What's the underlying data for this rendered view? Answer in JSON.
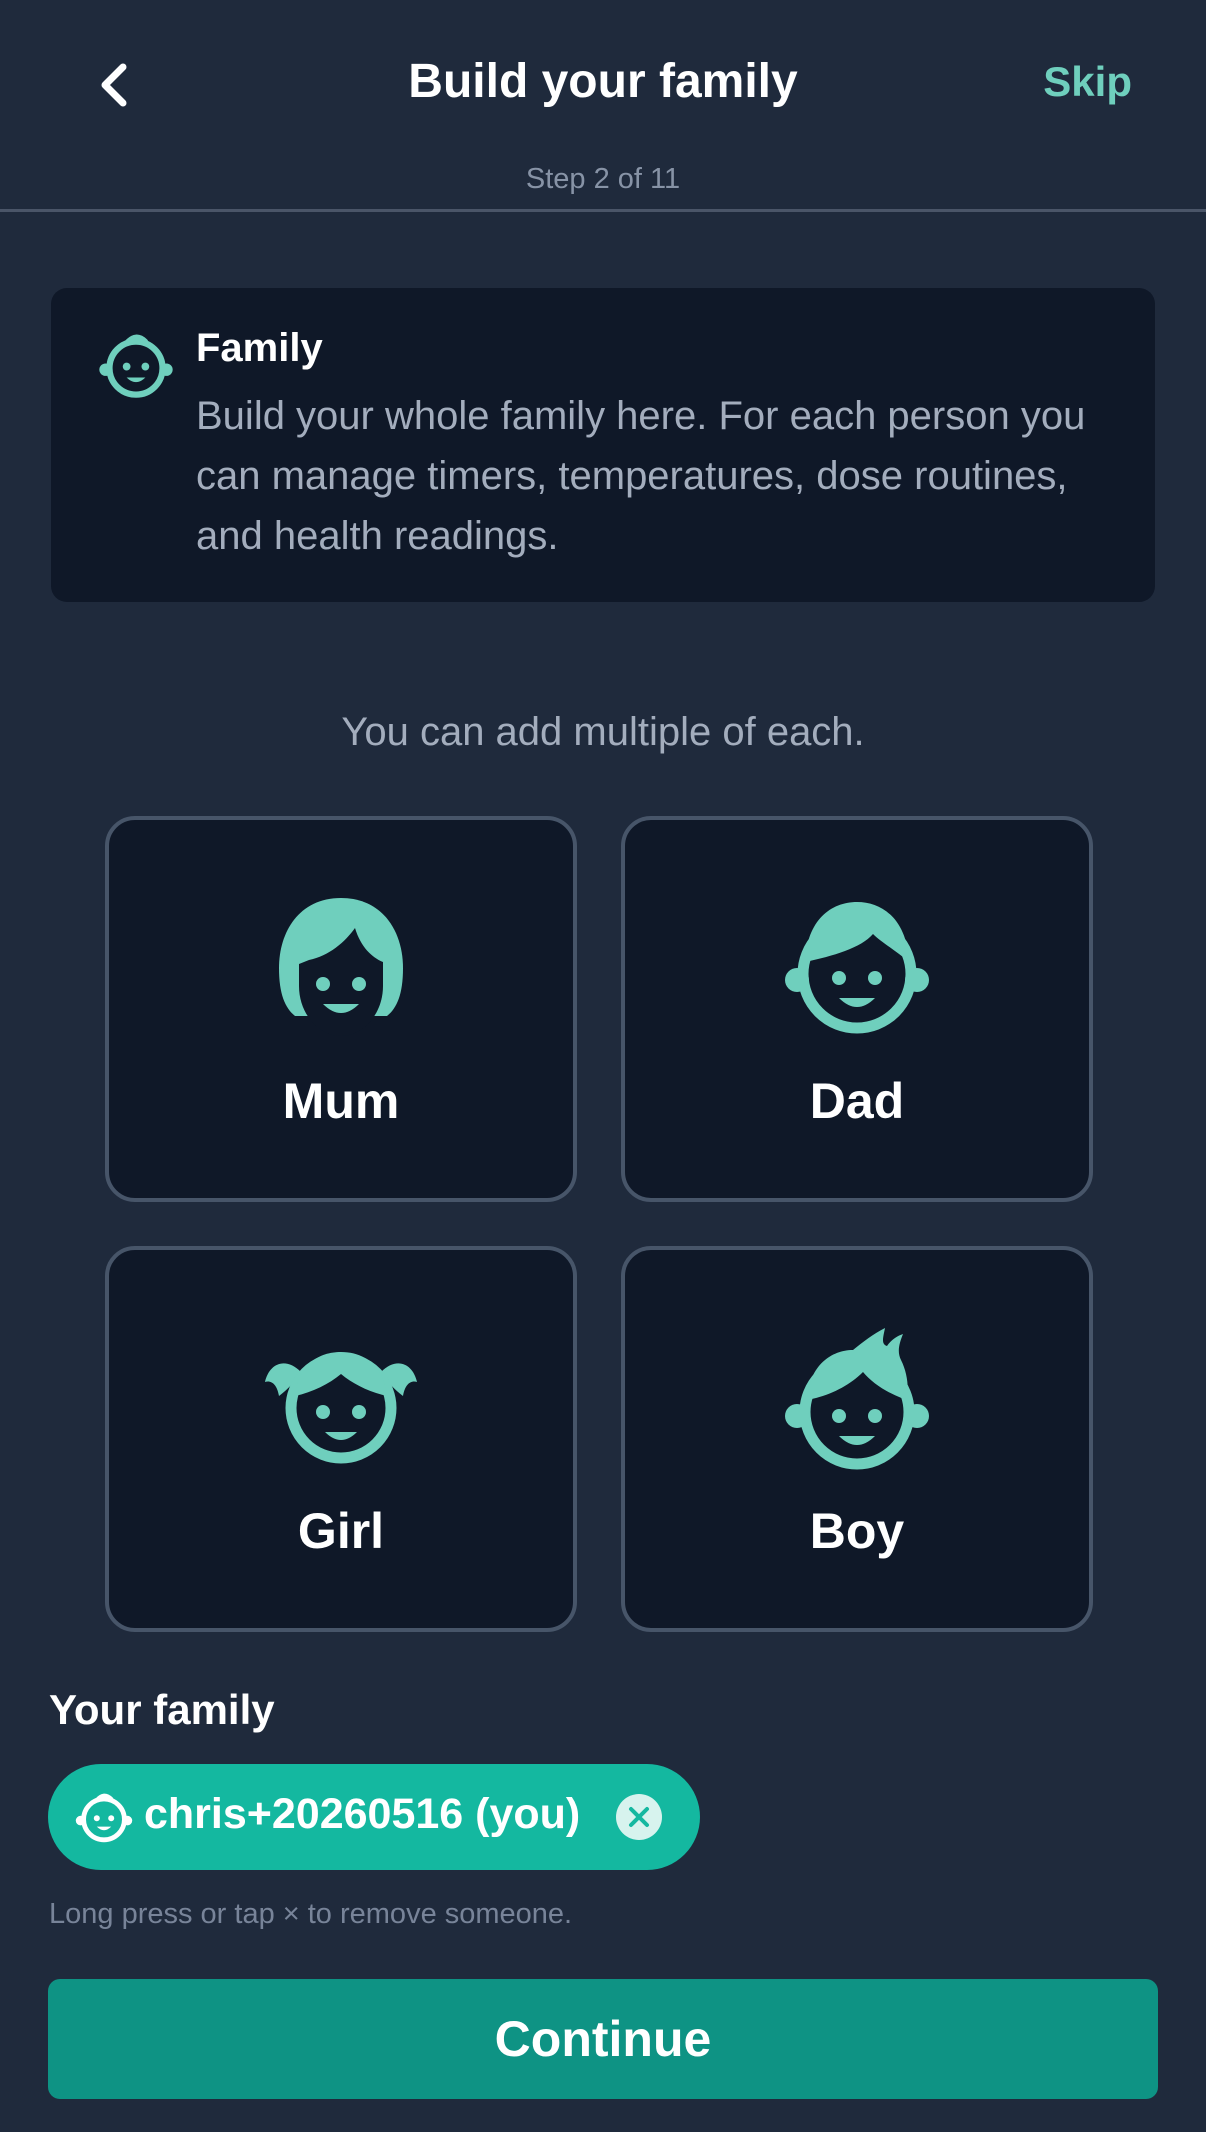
{
  "header": {
    "title": "Build your family",
    "skip_label": "Skip",
    "step_text": "Step 2 of 11"
  },
  "info_card": {
    "icon": "baby-face-icon",
    "title": "Family",
    "text": "Build your whole family here. For each person you can manage timers, temperatures, dose routines, and health readings."
  },
  "hint": "You can add multiple of each.",
  "members": [
    {
      "label": "Mum",
      "icon": "woman-face-icon"
    },
    {
      "label": "Dad",
      "icon": "man-face-icon"
    },
    {
      "label": "Girl",
      "icon": "girl-face-icon"
    },
    {
      "label": "Boy",
      "icon": "boy-face-icon"
    }
  ],
  "family": {
    "label": "Your family",
    "chips": [
      {
        "name": "chris+20260516 (you)",
        "icon": "baby-face-icon",
        "remove_icon": "close-icon"
      }
    ],
    "remove_hint": "Long press or tap × to remove someone."
  },
  "continue_label": "Continue",
  "colors": {
    "background": "#1f2a3c",
    "card": "#0f1828",
    "accent": "#6fcfbd",
    "chip": "#14b8a0",
    "button": "#0e9384"
  }
}
